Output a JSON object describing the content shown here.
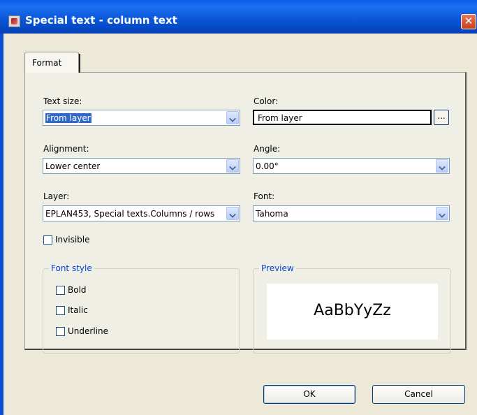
{
  "window": {
    "title": "Special text - column text",
    "close_glyph": "✕"
  },
  "tabs": [
    {
      "label": "Format"
    }
  ],
  "form": {
    "text_size": {
      "label": "Text size:",
      "value": "From layer"
    },
    "color": {
      "label": "Color:",
      "value": "From layer",
      "browse_label": "..."
    },
    "alignment": {
      "label": "Alignment:",
      "value": "Lower center"
    },
    "angle": {
      "label": "Angle:",
      "value": "0.00°"
    },
    "layer": {
      "label": "Layer:",
      "value": "EPLAN453, Special texts.Columns / rows"
    },
    "font": {
      "label": "Font:",
      "value": "Tahoma"
    },
    "invisible": {
      "label": "Invisible",
      "checked": false
    }
  },
  "font_style": {
    "title": "Font style",
    "bold": {
      "label": "Bold",
      "checked": false
    },
    "italic": {
      "label": "Italic",
      "checked": false
    },
    "underline": {
      "label": "Underline",
      "checked": false
    }
  },
  "preview": {
    "title": "Preview",
    "sample": "AaBbYyZz"
  },
  "buttons": {
    "ok": "OK",
    "cancel": "Cancel"
  },
  "colors": {
    "titlebar": "#0a5fe8",
    "dialog_bg": "#ece9d8",
    "selection": "#316ac5",
    "group_title": "#0046d5"
  },
  "icons": {
    "app": "special-text-icon",
    "close": "close-icon",
    "dropdown": "chevron-down-icon"
  }
}
